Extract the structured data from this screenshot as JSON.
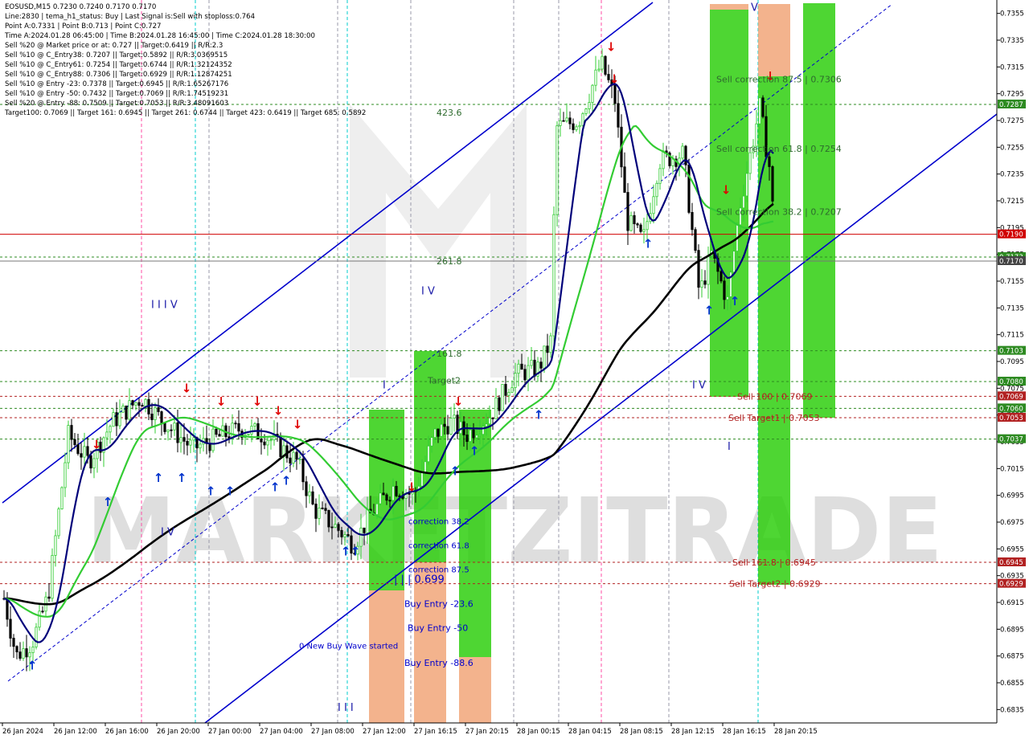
{
  "header": {
    "title": "EOSUSD,M15  0.7230 0.7240 0.7170 0.7170",
    "lines": [
      "Line:2830 | tema_h1_status: Buy | Last Signal is:Sell with stoploss:0.764",
      "Point A:0.7331 | Point B:0.713 | Point C:0.727",
      "Time A:2024.01.28 06:45:00 | Time B:2024.01.28 16:45:00 | Time C:2024.01.28 18:30:00",
      "Sell %20 @ Market price or at: 0.727 || Target:0.6419 || R/R:2.3",
      "Sell %10 @ C_Entry38: 0.7207 || Target:0.5892 || R/R:3.0369515",
      "Sell %10 @ C_Entry61: 0.7254 || Target:0.6744 || R/R:1.32124352",
      "Sell %10 @ C_Entry88: 0.7306 || Target:0.6929 || R/R:1.12874251",
      "Sell %10 @ Entry -23: 0.7378 || Target:0.6945 || R/R:1.65267176",
      "Sell %10 @ Entry -50: 0.7432 || Target:0.7069 || R/R:1.74519231",
      "Sell %20 @ Entry -88: 0.7509 || Target:0.7053 || R/R:3.48091603",
      "Target100: 0.7069 || Target 161: 0.6945 || Target 261: 0.6744 || Target 423: 0.6419 || Target 685: 0.5892"
    ]
  },
  "chart_data": {
    "type": "candlestick",
    "symbol": "EOSUSD",
    "timeframe": "M15",
    "ylim": [
      0.6825,
      0.7365
    ],
    "price_ticks": [
      "0.7355",
      "0.7335",
      "0.7315",
      "0.7295",
      "0.7275",
      "0.7255",
      "0.7235",
      "0.7215",
      "0.7195",
      "0.7175",
      "0.7155",
      "0.7135",
      "0.7115",
      "0.7095",
      "0.7075",
      "0.7055",
      "0.7035",
      "0.7015",
      "0.6995",
      "0.6975",
      "0.6955",
      "0.6935",
      "0.6915",
      "0.6895",
      "0.6875",
      "0.6855",
      "0.6835"
    ],
    "time_ticks": [
      "26 Jan 2024",
      "26 Jan 12:00",
      "26 Jan 16:00",
      "26 Jan 20:00",
      "27 Jan 00:00",
      "27 Jan 04:00",
      "27 Jan 08:00",
      "27 Jan 12:00",
      "27 Jan 16:15",
      "27 Jan 20:15",
      "28 Jan 00:15",
      "28 Jan 04:15",
      "28 Jan 08:15",
      "28 Jan 12:15",
      "28 Jan 16:15",
      "28 Jan 20:15"
    ],
    "price_labels": [
      {
        "text": "0.7287",
        "value": 0.7287,
        "color": "#2e8b22"
      },
      {
        "text": "0.7190",
        "value": 0.719,
        "color": "#d00000"
      },
      {
        "text": "0.7173",
        "value": 0.7173,
        "color": "#2e8b22"
      },
      {
        "text": "0.7170",
        "value": 0.717,
        "color": "#444444"
      },
      {
        "text": "0.7103",
        "value": 0.7103,
        "color": "#2e8b22"
      },
      {
        "text": "0.7080",
        "value": 0.708,
        "color": "#2e8b22"
      },
      {
        "text": "0.7069",
        "value": 0.7069,
        "color": "#b22222"
      },
      {
        "text": "0.7060",
        "value": 0.706,
        "color": "#2e8b22"
      },
      {
        "text": "0.7053",
        "value": 0.7053,
        "color": "#b22222"
      },
      {
        "text": "0.7037",
        "value": 0.7037,
        "color": "#2e8b22"
      },
      {
        "text": "0.6945",
        "value": 0.6945,
        "color": "#b22222"
      },
      {
        "text": "0.6929",
        "value": 0.6929,
        "color": "#b22222"
      }
    ],
    "hlines": [
      {
        "value": 0.7287,
        "color": "#2e8b22",
        "style": "dashed"
      },
      {
        "value": 0.719,
        "color": "#d00000",
        "style": "solid"
      },
      {
        "value": 0.7173,
        "color": "#2e8b22",
        "style": "dashed"
      },
      {
        "value": 0.717,
        "color": "#777777",
        "style": "solid"
      },
      {
        "value": 0.7103,
        "color": "#2e8b22",
        "style": "dashed"
      },
      {
        "value": 0.708,
        "color": "#2e8b22",
        "style": "dashed"
      },
      {
        "value": 0.7069,
        "color": "#b22222",
        "style": "dashed"
      },
      {
        "value": 0.706,
        "color": "#2e8b22",
        "style": "dashed"
      },
      {
        "value": 0.7053,
        "color": "#b22222",
        "style": "dashed"
      },
      {
        "value": 0.7037,
        "color": "#2e8b22",
        "style": "dashed"
      },
      {
        "value": 0.6945,
        "color": "#b22222",
        "style": "dashed"
      },
      {
        "value": 0.6929,
        "color": "#b22222",
        "style": "dashed"
      }
    ],
    "level_labels": [
      {
        "text": "423.6",
        "value": 0.7281,
        "color": "#2e6b2e"
      },
      {
        "text": "261.8",
        "value": 0.717,
        "color": "#2e6b2e"
      },
      {
        "text": "161.8",
        "value": 0.7101,
        "color": "#2e6b2e"
      },
      {
        "text": "Target2",
        "value": 0.7081,
        "color": "#2e6b2e"
      },
      {
        "text": "Sell correction 87.5 | 0.7306",
        "value": 0.7306,
        "color": "#2e6b2e"
      },
      {
        "text": "Sell correction 61.8 | 0.7254",
        "value": 0.7254,
        "color": "#2e6b2e"
      },
      {
        "text": "Sell correction 38.2 | 0.7207",
        "value": 0.7207,
        "color": "#2e6b2e"
      },
      {
        "text": "Sell 100 | 0.7069",
        "value": 0.7069,
        "color": "#b22222"
      },
      {
        "text": "Sell Target1 | 0.7053",
        "value": 0.7053,
        "color": "#b22222"
      },
      {
        "text": "Sell 161.8 | 0.6945",
        "value": 0.6945,
        "color": "#b22222"
      },
      {
        "text": "Sell Target2 | 0.6929",
        "value": 0.6929,
        "color": "#b22222"
      },
      {
        "text": "correction 38.2",
        "value": 0.6976,
        "color": "#0000cc"
      },
      {
        "text": "correction 61.8",
        "value": 0.6958,
        "color": "#0000cc"
      },
      {
        "text": "correction 87.5",
        "value": 0.694,
        "color": "#0000cc"
      },
      {
        "text": "| | | 0.699",
        "value": 0.6932,
        "color": "#0000cc"
      },
      {
        "text": "Buy Entry -23.6",
        "value": 0.6914,
        "color": "#0000cc"
      },
      {
        "text": "Buy Entry -50",
        "value": 0.6896,
        "color": "#0000cc"
      },
      {
        "text": "Buy Entry -88.6",
        "value": 0.687,
        "color": "#0000cc"
      },
      {
        "text": "0 New Buy Wave started",
        "value": 0.6883,
        "color": "#0000cc"
      }
    ],
    "wave_labels": [
      {
        "text": "I I I V",
        "value": 0.7138
      },
      {
        "text": "I V",
        "value": 0.7148
      },
      {
        "text": "I V",
        "value": 0.6968
      },
      {
        "text": "I",
        "value": 0.7078
      },
      {
        "text": "I V",
        "value": 0.7078
      },
      {
        "text": "I",
        "value": 0.7032
      },
      {
        "text": "V",
        "value": 0.736
      },
      {
        "text": "I I I",
        "value": 0.6837
      }
    ],
    "watermark": "MARKETZITRADE",
    "series": [
      {
        "name": "",
        "color": "#00007a",
        "kind": "fast-ma"
      },
      {
        "name": "",
        "color": "#33cc33",
        "kind": "mid-ma"
      },
      {
        "name": "",
        "color": "#000000",
        "kind": "slow-ma"
      }
    ]
  }
}
